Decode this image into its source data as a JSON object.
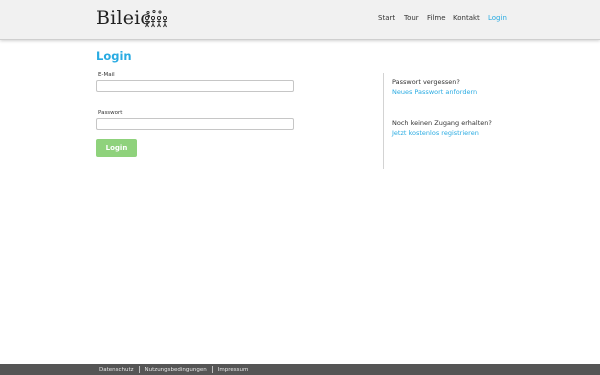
{
  "brand": {
    "logo_text": "Bileic"
  },
  "nav": {
    "items": [
      {
        "label": "Start"
      },
      {
        "label": "Tour"
      },
      {
        "label": "Filme"
      },
      {
        "label": "Kontakt"
      },
      {
        "label": "Login",
        "active": true
      }
    ]
  },
  "login": {
    "title": "Login",
    "email_label": "E-Mail",
    "email_value": "",
    "password_label": "Passwort",
    "password_value": "",
    "submit_label": "Login"
  },
  "side": {
    "forgot_heading": "Passwort vergessen?",
    "forgot_link": "Neues Passwort anfordern",
    "register_heading": "Noch keinen Zugang erhalten?",
    "register_link": "Jetzt kostenlos registrieren"
  },
  "footer": {
    "links": [
      "Datenschutz",
      "Nutzungsbedingungen",
      "Impressum"
    ]
  },
  "colors": {
    "accent": "#29abe2",
    "button": "#8fd27c",
    "footer_bg": "#555555",
    "header_bg": "#f1f1f1"
  }
}
